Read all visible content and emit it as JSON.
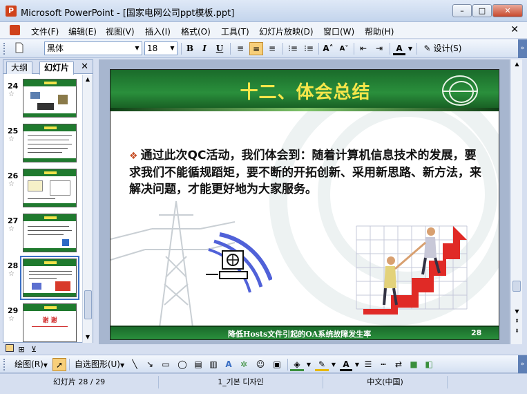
{
  "window": {
    "title": "Microsoft PowerPoint - [国家电网公司ppt模板.ppt]",
    "minimize": "–",
    "maximize": "□",
    "close": "✕"
  },
  "menu": {
    "items": [
      "文件(F)",
      "编辑(E)",
      "视图(V)",
      "插入(I)",
      "格式(O)",
      "工具(T)",
      "幻灯片放映(D)",
      "窗口(W)",
      "帮助(H)"
    ],
    "doc_close": "✕"
  },
  "toolbar": {
    "font_name": "黑体",
    "font_size": "18",
    "bold": "B",
    "italic": "I",
    "underline": "U",
    "design_label": "设计(S)"
  },
  "left_panel": {
    "tabs": [
      "大纲",
      "幻灯片"
    ],
    "close": "✕",
    "slide_numbers": [
      "24",
      "25",
      "26",
      "27",
      "28",
      "29"
    ],
    "slide29_title": "谢 谢",
    "selected": "28"
  },
  "slide": {
    "title": "十二、体会总结",
    "body": "通过此次QC活动，我们体会到：随着计算机信息技术的发展，要求我们不能循规蹈矩，要不断的开拓创新、采用新思路、新方法，来解决问题，才能更好地为大家服务。",
    "bullet": "❖",
    "footer_text": "降低Hosts文件引起的OA系统故障发生率",
    "footer_number": "28"
  },
  "drawbar": {
    "draw_label": "绘图(R)",
    "autoshape_label": "自选图形(U)"
  },
  "status": {
    "slide_position": "幻灯片 28 / 29",
    "design_name": "1_기본 디자인",
    "language": "中文(中国)"
  }
}
